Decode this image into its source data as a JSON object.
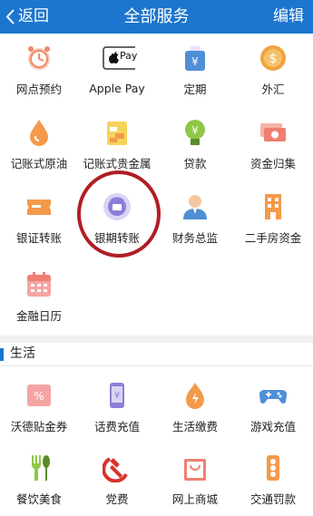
{
  "header": {
    "back_label": "返回",
    "title": "全部服务",
    "edit_label": "编辑"
  },
  "services": [
    {
      "label": "网点预约",
      "icon": "clock-icon"
    },
    {
      "label": "Apple Pay",
      "icon": "apple-pay-icon",
      "badge_text": "Pay"
    },
    {
      "label": "定期",
      "icon": "yen-bag-icon"
    },
    {
      "label": "外汇",
      "icon": "dollar-coin-icon"
    },
    {
      "label": "记账式原油",
      "icon": "oil-drop-icon"
    },
    {
      "label": "记账式贵金属",
      "icon": "gold-bars-icon"
    },
    {
      "label": "贷款",
      "icon": "lightbulb-yen-icon"
    },
    {
      "label": "资金归集",
      "icon": "money-notes-icon"
    },
    {
      "label": "银证转账",
      "icon": "ticket-icon"
    },
    {
      "label": "银期转账",
      "icon": "futures-transfer-icon"
    },
    {
      "label": "财务总监",
      "icon": "person-icon"
    },
    {
      "label": "二手房资金",
      "icon": "building-icon"
    },
    {
      "label": "金融日历",
      "icon": "calendar-icon"
    }
  ],
  "life_section": {
    "title": "生活",
    "items": [
      {
        "label": "沃德贴金券",
        "icon": "coupon-icon"
      },
      {
        "label": "话费充值",
        "icon": "phone-icon"
      },
      {
        "label": "生活缴费",
        "icon": "flame-icon"
      },
      {
        "label": "游戏充值",
        "icon": "gamepad-icon"
      },
      {
        "label": "餐饮美食",
        "icon": "fork-spoon-icon"
      },
      {
        "label": "党费",
        "icon": "hammer-sickle-icon"
      },
      {
        "label": "网上商城",
        "icon": "shopping-bag-icon"
      },
      {
        "label": "交通罚款",
        "icon": "traffic-light-icon"
      }
    ]
  },
  "colors": {
    "header_bg": "#1c75ce",
    "highlight_circle": "#b01e23",
    "icon_orange": "#f39a4b",
    "icon_blue": "#4f8fd6"
  }
}
